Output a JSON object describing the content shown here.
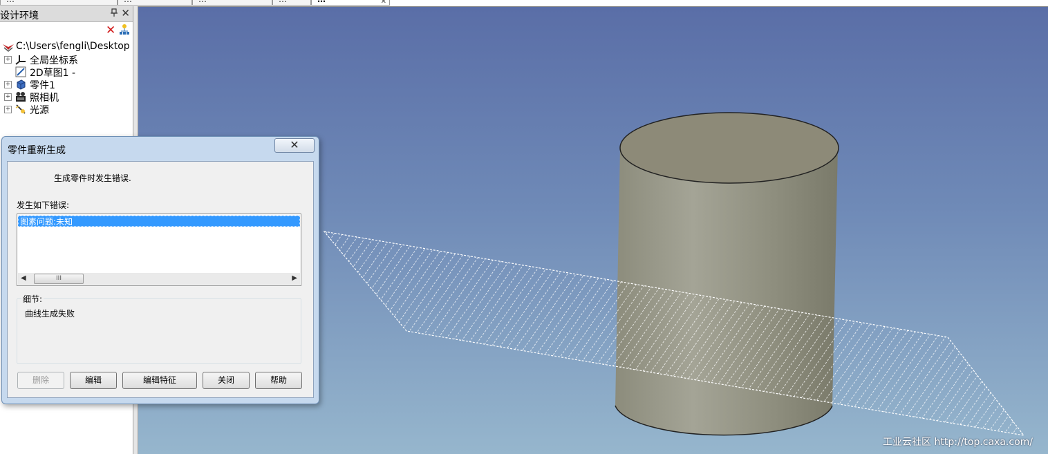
{
  "tabs": [
    {
      "label": "…"
    },
    {
      "label": "…"
    },
    {
      "label": "…"
    },
    {
      "label": "…"
    },
    {
      "label": "…",
      "active": true
    }
  ],
  "design_panel": {
    "title": "设计环境",
    "pin_glyph": "ᵖ",
    "close_glyph": "✕",
    "toolbar": {
      "delete_glyph": "✕",
      "icons": [
        "delete-icon",
        "tree-tool-icon"
      ]
    },
    "tree": [
      {
        "label": "C:\\Users\\fengli\\Desktop",
        "icon": "design-root-icon",
        "expander": false
      },
      {
        "label": "全局坐标系",
        "icon": "coordinate-system-icon",
        "expander": true
      },
      {
        "label": "2D草图1 -",
        "icon": "sketch-icon",
        "expander": false
      },
      {
        "label": "零件1",
        "icon": "part-icon",
        "expander": true
      },
      {
        "label": "照相机",
        "icon": "camera-icon",
        "expander": true
      },
      {
        "label": "光源",
        "icon": "light-icon",
        "expander": true
      }
    ]
  },
  "dialog": {
    "title": "零件重新生成",
    "close_glyph": "✕",
    "message": "生成零件时发生错误.",
    "errors_label": "发生如下错误:",
    "errors": [
      "图素问题:未知"
    ],
    "scroll_left": "◀",
    "scroll_right": "▶",
    "scroll_thumb": "III",
    "details_label": "细节:",
    "details_text": "曲线生成失败",
    "buttons": {
      "delete": "删除",
      "edit": "编辑",
      "edit_feature": "编辑特征",
      "close": "关闭",
      "help": "帮助"
    }
  },
  "viewport": {
    "background_top": "#5a6ea7",
    "background_bottom": "#96b6cd",
    "cylinder_color": "#9a9a88",
    "plane_hatch_color": "#ffffff",
    "watermark": "工业云社区 http://top.caxa.com/"
  }
}
